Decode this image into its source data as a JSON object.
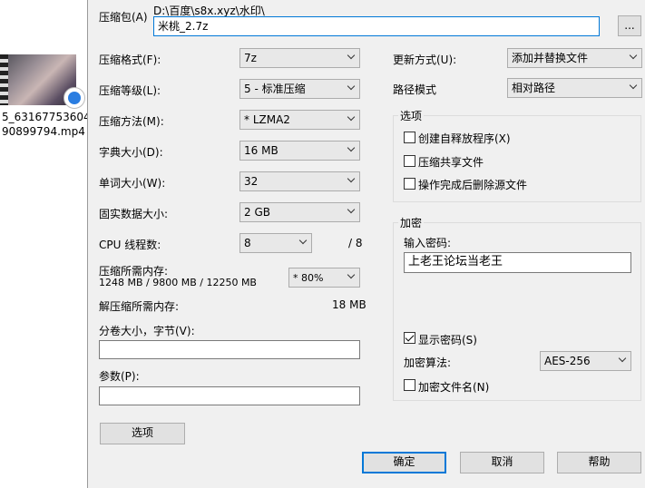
{
  "explorer": {
    "file_name_line1": "5_63167753604",
    "file_name_line2": "90899794.mp4"
  },
  "dialog": {
    "archive_label": "压缩包(A)",
    "archive_path": "D:\\百度\\s8x.xyz\\水印\\",
    "archive_name": "米桃_2.7z",
    "browse_label": "...",
    "format_label": "压缩格式(F):",
    "format_value": "7z",
    "level_label": "压缩等级(L):",
    "level_value": "5 - 标准压缩",
    "method_label": "压缩方法(M):",
    "method_value": "*  LZMA2",
    "dict_label": "字典大小(D):",
    "dict_value": "16 MB",
    "word_label": "单词大小(W):",
    "word_value": "32",
    "solid_label": "固实数据大小:",
    "solid_value": "2 GB",
    "cpu_label": "CPU 线程数:",
    "cpu_value": "8",
    "cpu_total": "/ 8",
    "mem_label": "压缩所需内存:",
    "mem_value": "1248 MB / 9800 MB / 12250 MB",
    "mem_percent": "* 80%",
    "decomp_label": "解压缩所需内存:",
    "decomp_value": "18 MB",
    "split_label": "分卷大小，字节(V):",
    "split_value": "",
    "params_label": "参数(P):",
    "params_value": "",
    "options_button": "选项",
    "update_label": "更新方式(U):",
    "update_value": "添加并替换文件",
    "path_label": "路径模式",
    "path_value": "相对路径",
    "options_group": "选项",
    "opt_sfx": "创建自释放程序(X)",
    "opt_shared": "压缩共享文件",
    "opt_delete": "操作完成后删除源文件",
    "encrypt_group": "加密",
    "password_label": "输入密码:",
    "password_value": "上老王论坛当老王",
    "show_password": "显示密码(S)",
    "algo_label": "加密算法:",
    "algo_value": "AES-256",
    "encrypt_names": "加密文件名(N)",
    "ok_button": "确定",
    "cancel_button": "取消",
    "help_button": "帮助"
  }
}
